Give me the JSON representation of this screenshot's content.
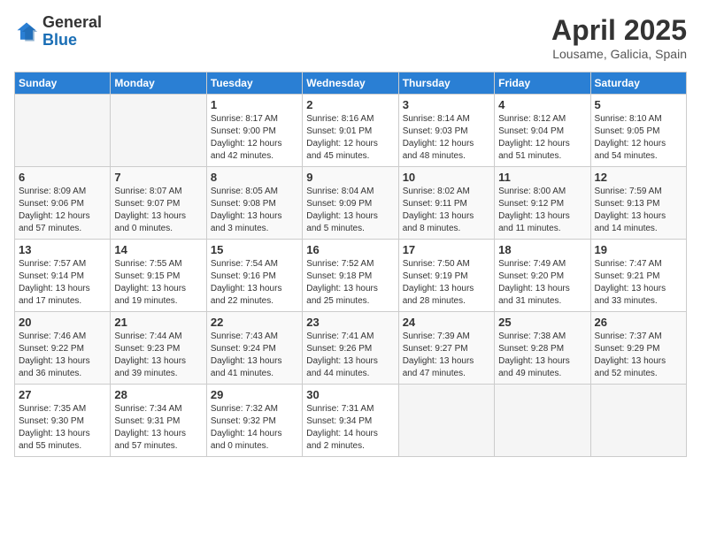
{
  "header": {
    "logo_general": "General",
    "logo_blue": "Blue",
    "month": "April 2025",
    "location": "Lousame, Galicia, Spain"
  },
  "days_of_week": [
    "Sunday",
    "Monday",
    "Tuesday",
    "Wednesday",
    "Thursday",
    "Friday",
    "Saturday"
  ],
  "weeks": [
    [
      {
        "day": "",
        "empty": true
      },
      {
        "day": "",
        "empty": true
      },
      {
        "day": "1",
        "sunrise": "Sunrise: 8:17 AM",
        "sunset": "Sunset: 9:00 PM",
        "daylight": "Daylight: 12 hours and 42 minutes."
      },
      {
        "day": "2",
        "sunrise": "Sunrise: 8:16 AM",
        "sunset": "Sunset: 9:01 PM",
        "daylight": "Daylight: 12 hours and 45 minutes."
      },
      {
        "day": "3",
        "sunrise": "Sunrise: 8:14 AM",
        "sunset": "Sunset: 9:03 PM",
        "daylight": "Daylight: 12 hours and 48 minutes."
      },
      {
        "day": "4",
        "sunrise": "Sunrise: 8:12 AM",
        "sunset": "Sunset: 9:04 PM",
        "daylight": "Daylight: 12 hours and 51 minutes."
      },
      {
        "day": "5",
        "sunrise": "Sunrise: 8:10 AM",
        "sunset": "Sunset: 9:05 PM",
        "daylight": "Daylight: 12 hours and 54 minutes."
      }
    ],
    [
      {
        "day": "6",
        "sunrise": "Sunrise: 8:09 AM",
        "sunset": "Sunset: 9:06 PM",
        "daylight": "Daylight: 12 hours and 57 minutes."
      },
      {
        "day": "7",
        "sunrise": "Sunrise: 8:07 AM",
        "sunset": "Sunset: 9:07 PM",
        "daylight": "Daylight: 13 hours and 0 minutes."
      },
      {
        "day": "8",
        "sunrise": "Sunrise: 8:05 AM",
        "sunset": "Sunset: 9:08 PM",
        "daylight": "Daylight: 13 hours and 3 minutes."
      },
      {
        "day": "9",
        "sunrise": "Sunrise: 8:04 AM",
        "sunset": "Sunset: 9:09 PM",
        "daylight": "Daylight: 13 hours and 5 minutes."
      },
      {
        "day": "10",
        "sunrise": "Sunrise: 8:02 AM",
        "sunset": "Sunset: 9:11 PM",
        "daylight": "Daylight: 13 hours and 8 minutes."
      },
      {
        "day": "11",
        "sunrise": "Sunrise: 8:00 AM",
        "sunset": "Sunset: 9:12 PM",
        "daylight": "Daylight: 13 hours and 11 minutes."
      },
      {
        "day": "12",
        "sunrise": "Sunrise: 7:59 AM",
        "sunset": "Sunset: 9:13 PM",
        "daylight": "Daylight: 13 hours and 14 minutes."
      }
    ],
    [
      {
        "day": "13",
        "sunrise": "Sunrise: 7:57 AM",
        "sunset": "Sunset: 9:14 PM",
        "daylight": "Daylight: 13 hours and 17 minutes."
      },
      {
        "day": "14",
        "sunrise": "Sunrise: 7:55 AM",
        "sunset": "Sunset: 9:15 PM",
        "daylight": "Daylight: 13 hours and 19 minutes."
      },
      {
        "day": "15",
        "sunrise": "Sunrise: 7:54 AM",
        "sunset": "Sunset: 9:16 PM",
        "daylight": "Daylight: 13 hours and 22 minutes."
      },
      {
        "day": "16",
        "sunrise": "Sunrise: 7:52 AM",
        "sunset": "Sunset: 9:18 PM",
        "daylight": "Daylight: 13 hours and 25 minutes."
      },
      {
        "day": "17",
        "sunrise": "Sunrise: 7:50 AM",
        "sunset": "Sunset: 9:19 PM",
        "daylight": "Daylight: 13 hours and 28 minutes."
      },
      {
        "day": "18",
        "sunrise": "Sunrise: 7:49 AM",
        "sunset": "Sunset: 9:20 PM",
        "daylight": "Daylight: 13 hours and 31 minutes."
      },
      {
        "day": "19",
        "sunrise": "Sunrise: 7:47 AM",
        "sunset": "Sunset: 9:21 PM",
        "daylight": "Daylight: 13 hours and 33 minutes."
      }
    ],
    [
      {
        "day": "20",
        "sunrise": "Sunrise: 7:46 AM",
        "sunset": "Sunset: 9:22 PM",
        "daylight": "Daylight: 13 hours and 36 minutes."
      },
      {
        "day": "21",
        "sunrise": "Sunrise: 7:44 AM",
        "sunset": "Sunset: 9:23 PM",
        "daylight": "Daylight: 13 hours and 39 minutes."
      },
      {
        "day": "22",
        "sunrise": "Sunrise: 7:43 AM",
        "sunset": "Sunset: 9:24 PM",
        "daylight": "Daylight: 13 hours and 41 minutes."
      },
      {
        "day": "23",
        "sunrise": "Sunrise: 7:41 AM",
        "sunset": "Sunset: 9:26 PM",
        "daylight": "Daylight: 13 hours and 44 minutes."
      },
      {
        "day": "24",
        "sunrise": "Sunrise: 7:39 AM",
        "sunset": "Sunset: 9:27 PM",
        "daylight": "Daylight: 13 hours and 47 minutes."
      },
      {
        "day": "25",
        "sunrise": "Sunrise: 7:38 AM",
        "sunset": "Sunset: 9:28 PM",
        "daylight": "Daylight: 13 hours and 49 minutes."
      },
      {
        "day": "26",
        "sunrise": "Sunrise: 7:37 AM",
        "sunset": "Sunset: 9:29 PM",
        "daylight": "Daylight: 13 hours and 52 minutes."
      }
    ],
    [
      {
        "day": "27",
        "sunrise": "Sunrise: 7:35 AM",
        "sunset": "Sunset: 9:30 PM",
        "daylight": "Daylight: 13 hours and 55 minutes."
      },
      {
        "day": "28",
        "sunrise": "Sunrise: 7:34 AM",
        "sunset": "Sunset: 9:31 PM",
        "daylight": "Daylight: 13 hours and 57 minutes."
      },
      {
        "day": "29",
        "sunrise": "Sunrise: 7:32 AM",
        "sunset": "Sunset: 9:32 PM",
        "daylight": "Daylight: 14 hours and 0 minutes."
      },
      {
        "day": "30",
        "sunrise": "Sunrise: 7:31 AM",
        "sunset": "Sunset: 9:34 PM",
        "daylight": "Daylight: 14 hours and 2 minutes."
      },
      {
        "day": "",
        "empty": true
      },
      {
        "day": "",
        "empty": true
      },
      {
        "day": "",
        "empty": true
      }
    ]
  ]
}
